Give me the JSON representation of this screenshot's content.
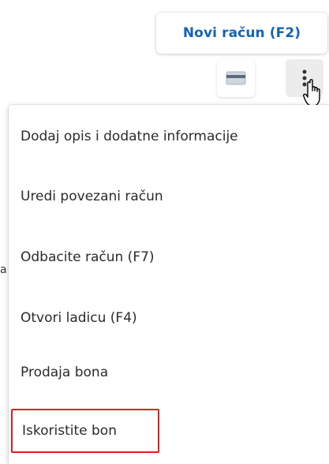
{
  "header": {
    "new_receipt_label": "Novi račun (F2)"
  },
  "toolbar": {
    "card_icon": "credit-card-icon",
    "more_icon": "more-vertical-icon"
  },
  "menu": {
    "items": [
      {
        "label": "Dodaj opis i dodatne informacije"
      },
      {
        "label": "Uredi povezani račun"
      },
      {
        "label": "Odbacite račun (F7)"
      },
      {
        "label": "Otvori ladicu (F4)"
      },
      {
        "label": "Prodaja bona"
      },
      {
        "label": "Iskoristite bon",
        "highlighted": true
      }
    ]
  },
  "colors": {
    "accent": "#1463b8",
    "highlight_border": "#e21b23",
    "menu_text": "#2b2b2b"
  }
}
